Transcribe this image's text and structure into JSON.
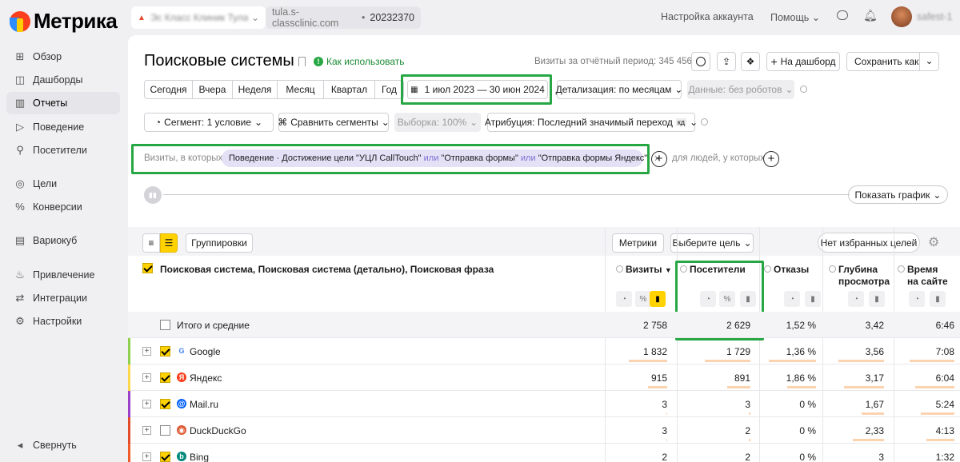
{
  "app": {
    "name": "Метрика"
  },
  "sidebar": {
    "items": [
      {
        "label": "Обзор",
        "icon": "grid-icon"
      },
      {
        "label": "Дашборды",
        "icon": "dashboard-icon"
      },
      {
        "label": "Отчеты",
        "icon": "reports-icon",
        "active": true
      },
      {
        "label": "Поведение",
        "icon": "play-icon"
      },
      {
        "label": "Посетители",
        "icon": "person-icon"
      },
      {
        "label": "Цели",
        "icon": "target-icon"
      },
      {
        "label": "Конверсии",
        "icon": "percent-icon"
      },
      {
        "label": "Вариокуб",
        "icon": "cube-icon"
      },
      {
        "label": "Привлечение",
        "icon": "flame-icon"
      },
      {
        "label": "Интеграции",
        "icon": "integrations-icon"
      },
      {
        "label": "Настройки",
        "icon": "gear-icon"
      }
    ],
    "collapse": "Свернуть"
  },
  "topbar": {
    "counter_name": "Эс Класс Клиник Тула",
    "counter_domain": "tula.s-classclinic.com",
    "counter_id": "20232370",
    "account_settings": "Настройка аккаунта",
    "help": "Помощь",
    "user": "safest-1"
  },
  "report": {
    "title": "Поисковые системы",
    "how_to": "Как использовать",
    "visits_period": "Визиты за отчётный период: 345 456",
    "to_dashboard": "На дашборд",
    "save_as": "Сохранить как"
  },
  "periods": [
    "Сегодня",
    "Вчера",
    "Неделя",
    "Месяц",
    "Квартал",
    "Год"
  ],
  "date_range": "1 июл 2023 — 30 июн 2024",
  "detail": "Детализация: по месяцам",
  "data_robots": "Данные: без роботов",
  "segment": "Сегмент: 1 условие",
  "compare": "Сравнить сегменты",
  "sample": "Выборка: 100%",
  "attribution": "Атрибуция: Последний значимый переход",
  "attribution_badge": "кд",
  "filter": {
    "prefix": "Визиты, в которых",
    "chip_a": "Поведение · Достижение цели \"УЦЛ CallTouch\"",
    "or1": "или",
    "chip_b": "\"Отправка формы\"",
    "or2": "или",
    "chip_c": "\"Отправка формы Яндекс\"",
    "people": "для людей, у которых"
  },
  "show_chart": "Показать график",
  "table_toolbar": {
    "groupings": "Группировки",
    "metrics": "Метрики",
    "choose_goal": "Выберите цель",
    "fav_goals": "Нет избранных целей"
  },
  "table": {
    "dims_header": "Поисковая система, Поисковая система (детально), Поисковая фраза",
    "columns": [
      {
        "l1": "Визиты",
        "l2": "",
        "sort": "▼"
      },
      {
        "l1": "Посетители",
        "l2": ""
      },
      {
        "l1": "Отказы",
        "l2": ""
      },
      {
        "l1": "Глубина",
        "l2": "просмотра"
      },
      {
        "l1": "Время",
        "l2": "на сайте"
      }
    ],
    "totals": {
      "label": "Итого и средние",
      "visits": "2 758",
      "users": "2 629",
      "bounce": "1,52 %",
      "depth": "3,42",
      "time": "6:46"
    },
    "rows": [
      {
        "name": "Google",
        "color": "#8fd14f",
        "checked": true,
        "visits": "1 832",
        "users": "1 729",
        "bounce": "1,36 %",
        "depth": "3,56",
        "time": "7:08",
        "icon": "google-icon",
        "bars": [
          0.66,
          0.66,
          0.9,
          0.8,
          0.8
        ]
      },
      {
        "name": "Яндекс",
        "color": "#ffd84d",
        "checked": true,
        "visits": "915",
        "users": "891",
        "bounce": "1,86 %",
        "depth": "3,17",
        "time": "6:04",
        "icon": "yandex-icon",
        "bars": [
          0.33,
          0.34,
          0.55,
          0.7,
          0.7
        ]
      },
      {
        "name": "Mail.ru",
        "color": "#9b40c9",
        "checked": true,
        "visits": "3",
        "users": "3",
        "bounce": "0 %",
        "depth": "1,67",
        "time": "5:24",
        "icon": "mailru-icon",
        "bars": [
          0.02,
          0.02,
          0,
          0.4,
          0.6
        ]
      },
      {
        "name": "DuckDuckGo",
        "color": "#e34c2b",
        "checked": false,
        "visits": "3",
        "users": "2",
        "bounce": "0 %",
        "depth": "2,33",
        "time": "4:13",
        "icon": "duckduckgo-icon",
        "bars": [
          0.02,
          0.02,
          0,
          0.55,
          0.5
        ]
      },
      {
        "name": "Bing",
        "color": "#f15a29",
        "checked": true,
        "visits": "2",
        "users": "2",
        "bounce": "0 %",
        "depth": "3",
        "time": "1:32",
        "icon": "bing-icon",
        "bars": [
          0.01,
          0.01,
          0,
          0.7,
          0.2
        ]
      }
    ]
  }
}
